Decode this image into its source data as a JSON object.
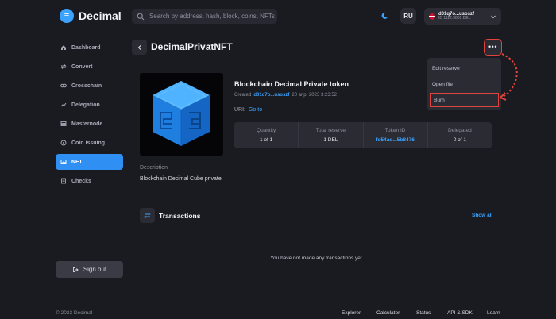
{
  "header": {
    "logo_text": "Decimal",
    "search_placeholder": "Search by address, hash, block, coins, NFTs",
    "lang": "RU",
    "account_address": "d01q7o...usoszf",
    "account_balance": "ID 1112.9809 DEL"
  },
  "sidebar": {
    "items": [
      {
        "label": "Dashboard",
        "icon": "home-icon"
      },
      {
        "label": "Convert",
        "icon": "convert-icon"
      },
      {
        "label": "Crosschain",
        "icon": "crosschain-icon"
      },
      {
        "label": "Delegation",
        "icon": "delegation-icon"
      },
      {
        "label": "Masternode",
        "icon": "server-icon"
      },
      {
        "label": "Coin issuing",
        "icon": "coin-icon"
      },
      {
        "label": "NFT",
        "icon": "image-icon",
        "active": true
      },
      {
        "label": "Checks",
        "icon": "checks-icon"
      }
    ],
    "sign_out": "Sign out"
  },
  "page": {
    "title": "DecimalPrivatNFT",
    "more_label": "•••"
  },
  "menu": {
    "items": [
      {
        "label": "Edit reserve"
      },
      {
        "label": "Open file"
      },
      {
        "label": "Burn",
        "highlighted": true
      }
    ]
  },
  "nft": {
    "name": "Blockchain Decimal Private token",
    "created_prefix": "Created",
    "created_address": "d01q7o...usoszf",
    "created_date": "20 апр. 2023 3:23:52",
    "uri_label": "URI:",
    "uri_link": "Go to",
    "stats": [
      {
        "label": "Quantity",
        "value": "1 of 1"
      },
      {
        "label": "Total reserve",
        "value": "1 DEL"
      },
      {
        "label": "Token ID",
        "value": "fd54ad...5b8476",
        "link": true
      },
      {
        "label": "Delegated",
        "value": "0 of 1"
      }
    ],
    "description_label": "Description",
    "description": "Blockchain Decimal Cube private"
  },
  "transactions": {
    "title": "Transactions",
    "show_all": "Show all",
    "empty": "You have not made any transactions yet"
  },
  "footer": {
    "copyright": "© 2023 Decimal",
    "links": [
      "Explorer",
      "Calculator",
      "Status",
      "API & SDK",
      "Learn"
    ]
  },
  "colors": {
    "accent": "#2f8ff3",
    "highlight": "#e0443c",
    "background": "#1a1b20"
  }
}
